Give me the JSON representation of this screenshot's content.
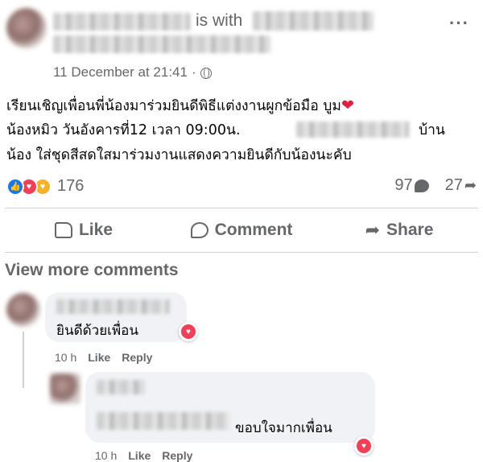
{
  "post": {
    "with_label": "is with",
    "timestamp": "11 December at 21:41",
    "separator": "·",
    "text_lines": [
      "เรียนเชิญเพื่อนพี่น้องมาร่วมยินดีพิธีแต่งงานผูกข้อมือ บูม",
      "น้องหมิว วันอังคารที่12 เวลา 09:00น.",
      "บ้าน",
      "น้อง ใส่ชุดสีสดใสมาร่วมงานแสดงความยินดีกับน้องนะคับ"
    ],
    "inline_emoji": "❤",
    "more_label": "···"
  },
  "stats": {
    "reaction_count": "176",
    "comment_count": "97",
    "share_count": "27"
  },
  "actions": {
    "like": "Like",
    "comment": "Comment",
    "share": "Share"
  },
  "comments": {
    "view_more": "View more comments",
    "items": [
      {
        "text": "ยินดีด้วยเพื่อน",
        "time": "10 h",
        "like": "Like",
        "reply": "Reply"
      },
      {
        "text": "ขอบใจมากเพื่อน",
        "time": "10 h",
        "like": "Like",
        "reply": "Reply"
      }
    ]
  },
  "colors": {
    "accent": "#1877f2",
    "love": "#f33e58",
    "secondary_text": "#65676b",
    "bubble_bg": "#f0f2f5"
  }
}
